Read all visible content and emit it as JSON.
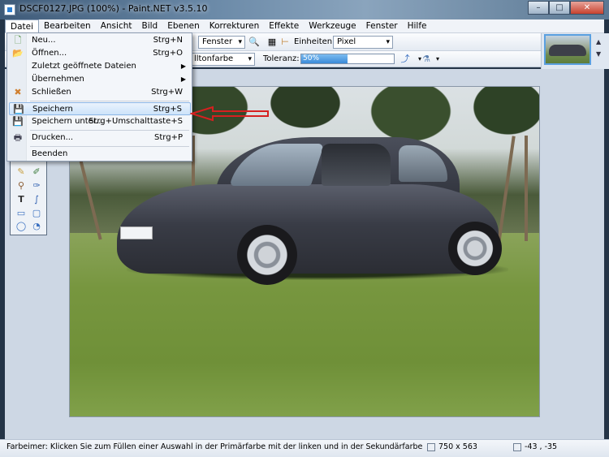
{
  "window": {
    "title": "DSCF0127.JPG (100%) - Paint.NET v3.5.10",
    "buttons": {
      "minimize": "–",
      "maximize": "□",
      "close": "✕"
    }
  },
  "menubar": {
    "items": [
      "Datei",
      "Bearbeiten",
      "Ansicht",
      "Bild",
      "Ebenen",
      "Korrekturen",
      "Effekte",
      "Werkzeuge",
      "Fenster",
      "Hilfe"
    ]
  },
  "toolbar": {
    "view_select": "Fenster",
    "units_label": "Einheiten:",
    "units_select": "Pixel",
    "fill_select": "lltonfarbe",
    "tolerance_label": "Toleranz:",
    "tolerance_value": "50%",
    "tolerance_fraction": 0.5
  },
  "file_menu": {
    "items": [
      {
        "label": "Neu...",
        "shortcut": "Strg+N",
        "icon": "new-file-icon"
      },
      {
        "label": "Öffnen...",
        "shortcut": "Strg+O",
        "icon": "open-folder-icon"
      },
      {
        "label": "Zuletzt geöffnete Dateien",
        "shortcut": "",
        "submenu": true
      },
      {
        "label": "Übernehmen",
        "shortcut": "",
        "submenu": true
      },
      {
        "label": "Schließen",
        "shortcut": "Strg+W",
        "icon": "close-file-icon"
      },
      {
        "label": "Speichern",
        "shortcut": "Strg+S",
        "icon": "floppy-disk-icon",
        "highlighted": true
      },
      {
        "label": "Speichern unter...",
        "shortcut": "Strg+Umschalttaste+S",
        "icon": "save-as-icon"
      },
      {
        "label": "Drucken...",
        "shortcut": "Strg+P",
        "icon": "printer-icon"
      },
      {
        "label": "Beenden",
        "shortcut": ""
      }
    ]
  },
  "statusbar": {
    "hint": "Farbeimer: Klicken Sie zum Füllen einer Auswahl in der Primärfarbe mit der linken und in der Sekundärfarbe mit der rechten M",
    "image_size": "750 x 563",
    "cursor": "-43 , -35"
  },
  "colors": {
    "accent": "#3a8ad8",
    "highlight": "#cde3fa",
    "arrow": "#d62020"
  }
}
